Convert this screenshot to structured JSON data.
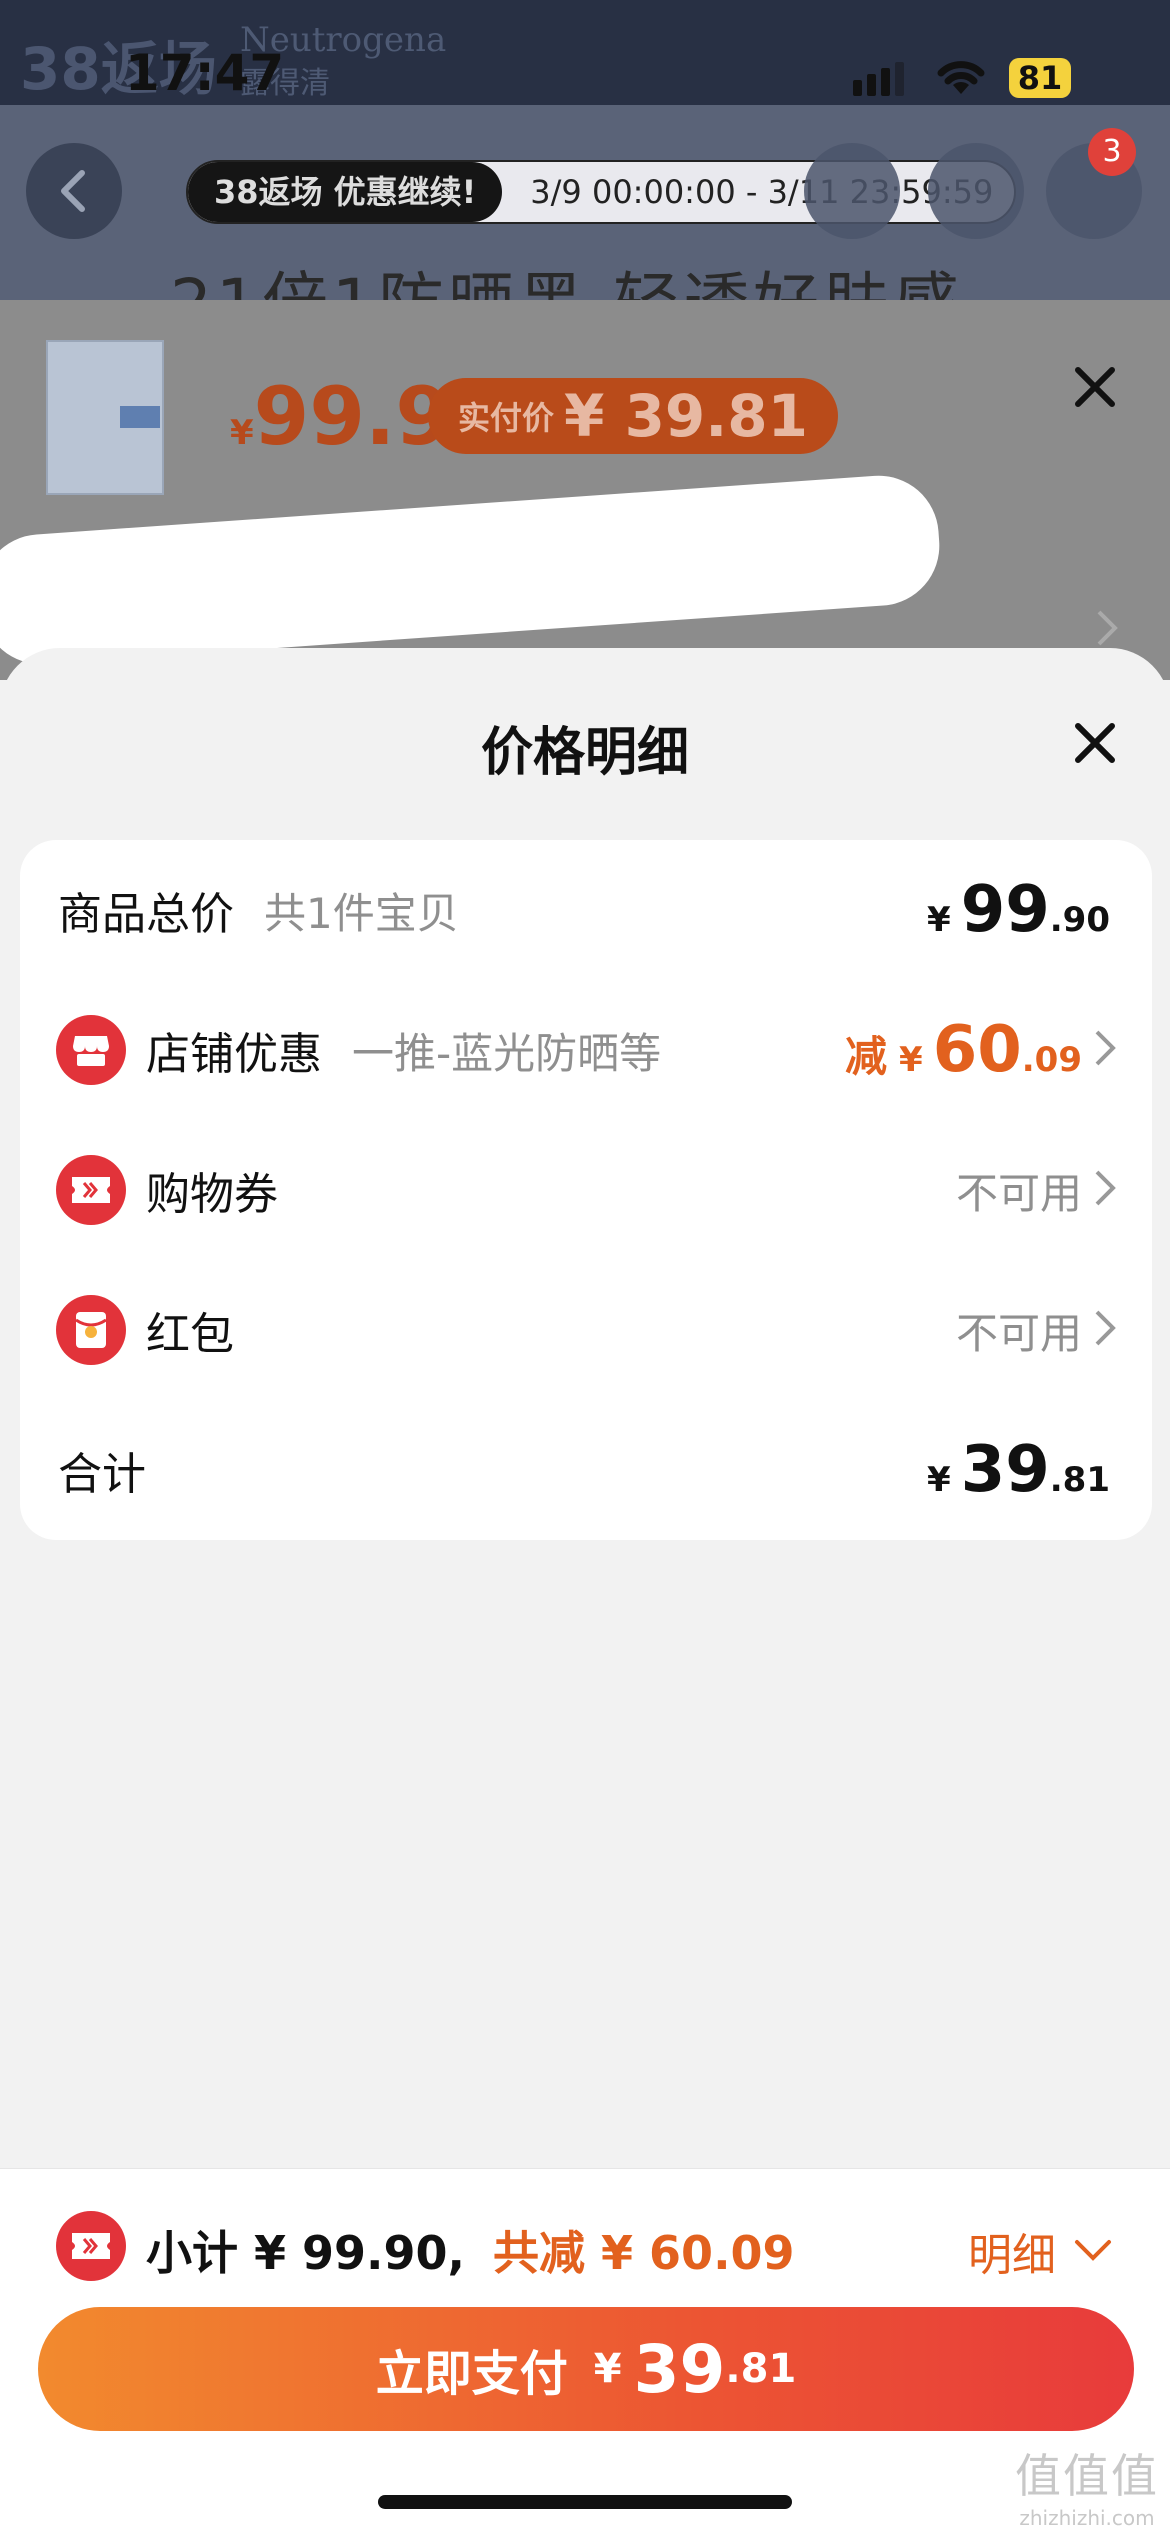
{
  "status_bar": {
    "time": "17:47",
    "battery": "81"
  },
  "product_page": {
    "brand_promo": "38返场",
    "brand_name": "Neutrogena",
    "brand_name_cn": "露得清",
    "promo_tag": "38返场 优惠继续!",
    "promo_time": "3/9 00:00:00 - 3/11 23:59:59",
    "cart_badge": "3",
    "title_partial": "21倍1防晒黑 轻透好肤感"
  },
  "sku": {
    "currency": "¥",
    "price": "99.9",
    "pay_label": "实付价",
    "pay_value": "¥ 39.81"
  },
  "sheet": {
    "title": "价格明细",
    "total_row": {
      "label": "商品总价",
      "sub": "共1件宝贝",
      "currency": "¥",
      "int": "99",
      "dec": ".90"
    },
    "store_discount": {
      "label": "店铺优惠",
      "sub": "一推-蓝光防晒等",
      "prefix": "减",
      "currency": "¥",
      "int": "60",
      "dec": ".09"
    },
    "coupon": {
      "label": "购物券",
      "value": "不可用"
    },
    "red_packet": {
      "label": "红包",
      "value": "不可用"
    },
    "sum_row": {
      "label": "合计",
      "currency": "¥",
      "int": "39",
      "dec": ".81"
    }
  },
  "footer": {
    "subtotal": "小计 ¥ 99.90,",
    "discount": "共减 ¥ 60.09",
    "detail": "明细",
    "pay_label": "立即支付",
    "pay_currency": "¥",
    "pay_int": "39",
    "pay_dec": ".81"
  },
  "watermark": {
    "line1": "值值值",
    "line2": "zhizhizhi.com"
  },
  "colors": {
    "accent": "#e2611e",
    "red": "#e2333a",
    "pay_start": "#f28a2e",
    "pay_end": "#e83b3b"
  }
}
